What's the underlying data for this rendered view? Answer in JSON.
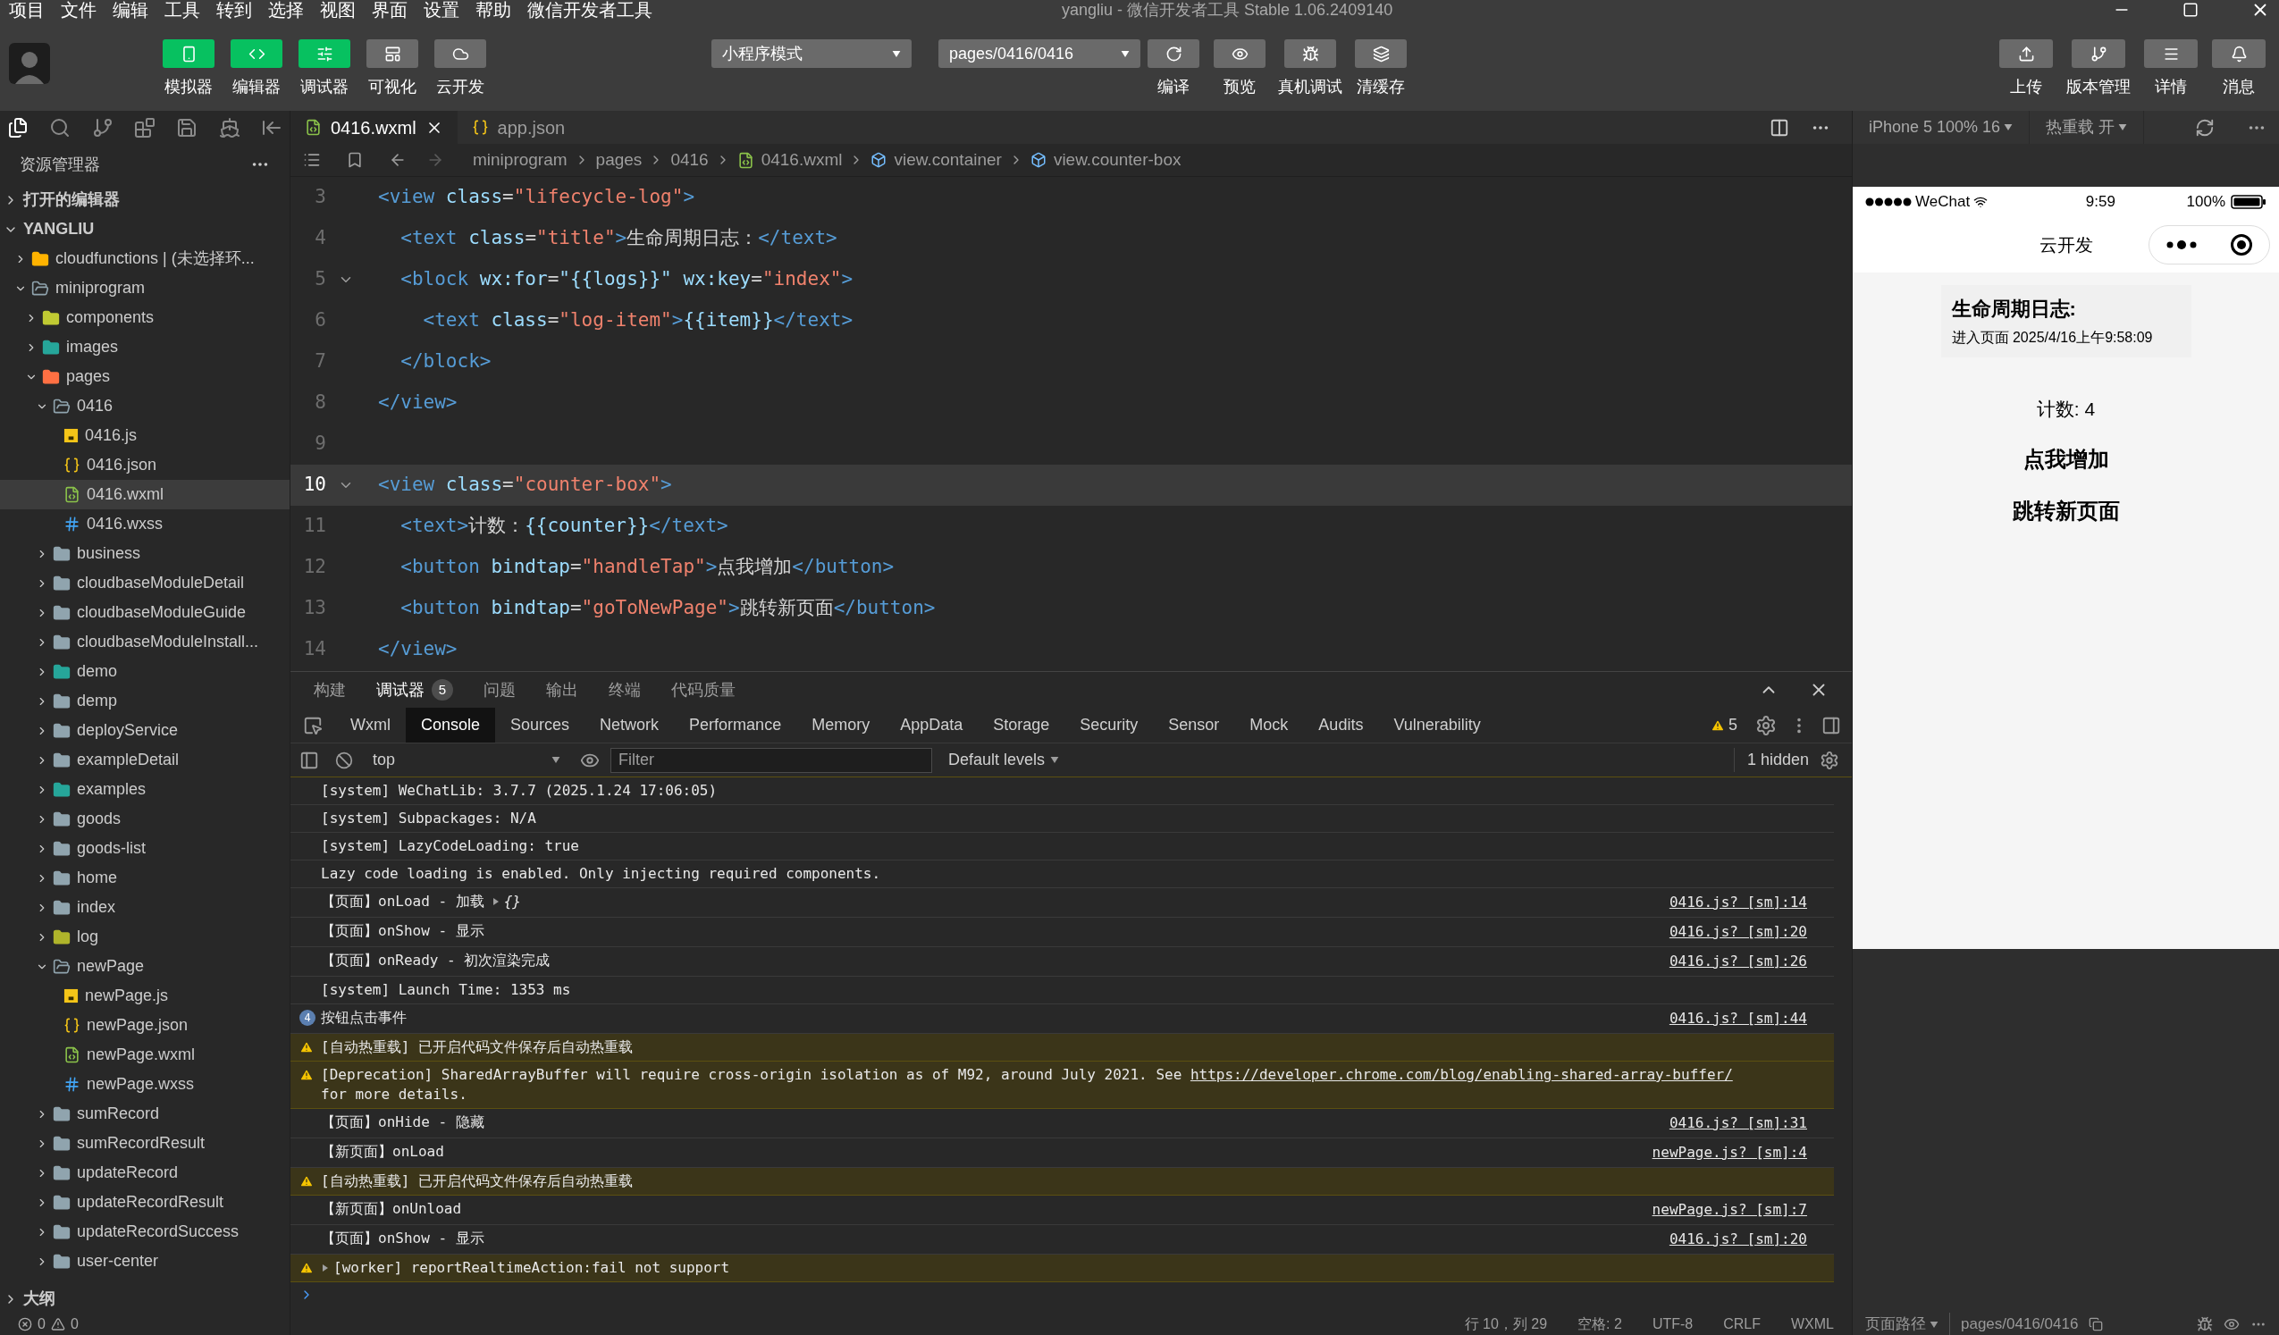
{
  "menu_bar": {
    "items": [
      "项目",
      "文件",
      "编辑",
      "工具",
      "转到",
      "选择",
      "视图",
      "界面",
      "设置",
      "帮助",
      "微信开发者工具"
    ],
    "title": "yangliu - 微信开发者工具 Stable 1.06.2409140"
  },
  "toolbar": {
    "modes": [
      {
        "label": "模拟器",
        "kind": "simulator",
        "on": true
      },
      {
        "label": "编辑器",
        "kind": "editor",
        "on": true
      },
      {
        "label": "调试器",
        "kind": "debugger",
        "on": true
      },
      {
        "label": "可视化",
        "kind": "visual",
        "on": false
      },
      {
        "label": "云开发",
        "kind": "cloud",
        "on": false
      }
    ],
    "mode_select": "小程序模式",
    "page_select": "pages/0416/0416",
    "actions": [
      {
        "label": "编译",
        "kind": "compile"
      },
      {
        "label": "预览",
        "kind": "preview"
      },
      {
        "label": "真机调试",
        "kind": "debug"
      },
      {
        "label": "清缓存",
        "kind": "cache"
      }
    ],
    "right_actions": [
      {
        "label": "上传",
        "kind": "upload"
      },
      {
        "label": "版本管理",
        "kind": "version"
      },
      {
        "label": "详情",
        "kind": "details"
      },
      {
        "label": "消息",
        "kind": "messages"
      }
    ]
  },
  "sidebar": {
    "title": "资源管理器",
    "sections": [
      {
        "label": "打开的编辑器",
        "expanded": false
      },
      {
        "label": "YANGLIU",
        "expanded": true,
        "children": [
          {
            "label": "cloudfunctions | (未选择环...",
            "kind": "cloud",
            "expanded": false,
            "selected": false
          },
          {
            "label": "miniprogram",
            "kind": "folder",
            "expanded": true,
            "selected": false,
            "children": [
              {
                "label": "components",
                "kind": "components",
                "expanded": false,
                "selected": false
              },
              {
                "label": "images",
                "kind": "images",
                "expanded": false,
                "selected": false
              },
              {
                "label": "pages",
                "kind": "pages",
                "expanded": true,
                "selected": false,
                "children": [
                  {
                    "label": "0416",
                    "kind": "folder",
                    "expanded": true,
                    "selected": false,
                    "children": [
                      {
                        "label": "0416.js",
                        "kind": "js",
                        "selected": false
                      },
                      {
                        "label": "0416.json",
                        "kind": "json",
                        "selected": false
                      },
                      {
                        "label": "0416.wxml",
                        "kind": "wxml",
                        "selected": true
                      },
                      {
                        "label": "0416.wxss",
                        "kind": "wxss",
                        "selected": false
                      }
                    ]
                  },
                  {
                    "label": "business",
                    "kind": "folder",
                    "expanded": false,
                    "selected": false
                  },
                  {
                    "label": "cloudbaseModuleDetail",
                    "kind": "folder",
                    "expanded": false,
                    "selected": false
                  },
                  {
                    "label": "cloudbaseModuleGuide",
                    "kind": "folder",
                    "expanded": false,
                    "selected": false
                  },
                  {
                    "label": "cloudbaseModuleInstall...",
                    "kind": "folder",
                    "expanded": false,
                    "selected": false
                  },
                  {
                    "label": "demo",
                    "kind": "images",
                    "expanded": false,
                    "selected": false
                  },
                  {
                    "label": "demp",
                    "kind": "folder",
                    "expanded": false,
                    "selected": false
                  },
                  {
                    "label": "deployService",
                    "kind": "folder",
                    "expanded": false,
                    "selected": false
                  },
                  {
                    "label": "exampleDetail",
                    "kind": "folder",
                    "expanded": false,
                    "selected": false
                  },
                  {
                    "label": "examples",
                    "kind": "images",
                    "expanded": false,
                    "selected": false
                  },
                  {
                    "label": "goods",
                    "kind": "folder",
                    "expanded": false,
                    "selected": false
                  },
                  {
                    "label": "goods-list",
                    "kind": "folder",
                    "expanded": false,
                    "selected": false
                  },
                  {
                    "label": "home",
                    "kind": "folder",
                    "expanded": false,
                    "selected": false
                  },
                  {
                    "label": "index",
                    "kind": "folder",
                    "expanded": false,
                    "selected": false
                  },
                  {
                    "label": "log",
                    "kind": "log",
                    "expanded": false,
                    "selected": false
                  },
                  {
                    "label": "newPage",
                    "kind": "folder",
                    "expanded": true,
                    "selected": false,
                    "children": [
                      {
                        "label": "newPage.js",
                        "kind": "js",
                        "selected": false
                      },
                      {
                        "label": "newPage.json",
                        "kind": "json",
                        "selected": false
                      },
                      {
                        "label": "newPage.wxml",
                        "kind": "wxml",
                        "selected": false
                      },
                      {
                        "label": "newPage.wxss",
                        "kind": "wxss",
                        "selected": false
                      }
                    ]
                  },
                  {
                    "label": "sumRecord",
                    "kind": "folder",
                    "expanded": false,
                    "selected": false
                  },
                  {
                    "label": "sumRecordResult",
                    "kind": "folder",
                    "expanded": false,
                    "selected": false
                  },
                  {
                    "label": "updateRecord",
                    "kind": "folder",
                    "expanded": false,
                    "selected": false
                  },
                  {
                    "label": "updateRecordResult",
                    "kind": "folder",
                    "expanded": false,
                    "selected": false
                  },
                  {
                    "label": "updateRecordSuccess",
                    "kind": "folder",
                    "expanded": false,
                    "selected": false
                  },
                  {
                    "label": "user-center",
                    "kind": "folder",
                    "expanded": false,
                    "selected": false
                  }
                ]
              }
            ]
          }
        ]
      },
      {
        "label": "大纲",
        "expanded": false
      }
    ]
  },
  "editor": {
    "tabs": [
      {
        "label": "0416.wxml",
        "kind": "wxml",
        "selected": true
      },
      {
        "label": "app.json",
        "kind": "json",
        "selected": false
      }
    ],
    "breadcrumb": [
      {
        "label": "miniprogram",
        "kind": "dir"
      },
      {
        "label": "pages",
        "kind": "dir"
      },
      {
        "label": "0416",
        "kind": "dir"
      },
      {
        "label": "0416.wxml",
        "kind": "wxml"
      },
      {
        "label": "view.container",
        "kind": "element"
      },
      {
        "label": "view.counter-box",
        "kind": "element"
      }
    ],
    "lines": [
      {
        "number": "3",
        "current": false,
        "foldable": false,
        "tokens": [
          {
            "t": "<view",
            "kind": "tag"
          },
          {
            "t": " class",
            "kind": "attr"
          },
          {
            "t": "=",
            "kind": "text"
          },
          {
            "t": "\"lifecycle-log\"",
            "kind": "str"
          },
          {
            "t": ">",
            "kind": "tag"
          }
        ]
      },
      {
        "number": "4",
        "current": false,
        "foldable": false,
        "tokens": [
          {
            "t": "  <text",
            "kind": "tag"
          },
          {
            "t": " class",
            "kind": "attr"
          },
          {
            "t": "=",
            "kind": "text"
          },
          {
            "t": "\"title\"",
            "kind": "str"
          },
          {
            "t": ">",
            "kind": "tag"
          },
          {
            "t": "生命周期日志：",
            "kind": "text"
          },
          {
            "t": "</text>",
            "kind": "tag"
          }
        ]
      },
      {
        "number": "5",
        "current": false,
        "foldable": true,
        "tokens": [
          {
            "t": "  <block",
            "kind": "tag"
          },
          {
            "t": " wx:for",
            "kind": "attr"
          },
          {
            "t": "=",
            "kind": "text"
          },
          {
            "t": "\"{{logs}}\"",
            "kind": "expr"
          },
          {
            "t": " wx:key",
            "kind": "attr"
          },
          {
            "t": "=",
            "kind": "text"
          },
          {
            "t": "\"index\"",
            "kind": "str"
          },
          {
            "t": ">",
            "kind": "tag"
          }
        ]
      },
      {
        "number": "6",
        "current": false,
        "foldable": false,
        "tokens": [
          {
            "t": "    <text",
            "kind": "tag"
          },
          {
            "t": " class",
            "kind": "attr"
          },
          {
            "t": "=",
            "kind": "text"
          },
          {
            "t": "\"log-item\"",
            "kind": "str"
          },
          {
            "t": ">",
            "kind": "tag"
          },
          {
            "t": "{{item}}",
            "kind": "expr"
          },
          {
            "t": "</text>",
            "kind": "tag"
          }
        ]
      },
      {
        "number": "7",
        "current": false,
        "foldable": false,
        "tokens": [
          {
            "t": "  </block>",
            "kind": "tag"
          }
        ]
      },
      {
        "number": "8",
        "current": false,
        "foldable": false,
        "tokens": [
          {
            "t": "</view>",
            "kind": "tag"
          }
        ]
      },
      {
        "number": "9",
        "current": false,
        "foldable": false
      },
      {
        "number": "10",
        "current": true,
        "foldable": true,
        "tokens": [
          {
            "t": "<view",
            "kind": "tag"
          },
          {
            "t": " class",
            "kind": "attr"
          },
          {
            "t": "=",
            "kind": "text"
          },
          {
            "t": "\"counter-box\"",
            "kind": "str"
          },
          {
            "t": ">",
            "kind": "tag"
          }
        ]
      },
      {
        "number": "11",
        "current": false,
        "foldable": false,
        "tokens": [
          {
            "t": "  <text>",
            "kind": "tag"
          },
          {
            "t": "计数：",
            "kind": "text"
          },
          {
            "t": "{{counter}}",
            "kind": "expr"
          },
          {
            "t": "</text>",
            "kind": "tag"
          }
        ]
      },
      {
        "number": "12",
        "current": false,
        "foldable": false,
        "tokens": [
          {
            "t": "  <button",
            "kind": "tag"
          },
          {
            "t": " bindtap",
            "kind": "attr"
          },
          {
            "t": "=",
            "kind": "text"
          },
          {
            "t": "\"handleTap\"",
            "kind": "str"
          },
          {
            "t": ">",
            "kind": "tag"
          },
          {
            "t": "点我增加",
            "kind": "text"
          },
          {
            "t": "</button>",
            "kind": "tag"
          }
        ]
      },
      {
        "number": "13",
        "current": false,
        "foldable": false,
        "tokens": [
          {
            "t": "  <button",
            "kind": "tag"
          },
          {
            "t": " bindtap",
            "kind": "attr"
          },
          {
            "t": "=",
            "kind": "text"
          },
          {
            "t": "\"goToNewPage\"",
            "kind": "str"
          },
          {
            "t": ">",
            "kind": "tag"
          },
          {
            "t": "跳转新页面",
            "kind": "text"
          },
          {
            "t": "</button>",
            "kind": "tag"
          }
        ]
      },
      {
        "number": "14",
        "current": false,
        "foldable": false,
        "tokens": [
          {
            "t": "</view>",
            "kind": "tag"
          }
        ]
      }
    ]
  },
  "panel": {
    "tabs": [
      {
        "label": "构建",
        "selected": false
      },
      {
        "label": "调试器",
        "selected": true,
        "badge": "5"
      },
      {
        "label": "问题",
        "selected": false
      },
      {
        "label": "输出",
        "selected": false
      },
      {
        "label": "终端",
        "selected": false
      },
      {
        "label": "代码质量",
        "selected": false
      }
    ],
    "devtools_tabs": [
      {
        "label": "Wxml",
        "selected": false
      },
      {
        "label": "Console",
        "selected": true
      },
      {
        "label": "Sources",
        "selected": false
      },
      {
        "label": "Network",
        "selected": false
      },
      {
        "label": "Performance",
        "selected": false
      },
      {
        "label": "Memory",
        "selected": false
      },
      {
        "label": "AppData",
        "selected": false
      },
      {
        "label": "Storage",
        "selected": false
      },
      {
        "label": "Security",
        "selected": false
      },
      {
        "label": "Sensor",
        "selected": false
      },
      {
        "label": "Mock",
        "selected": false
      },
      {
        "label": "Audits",
        "selected": false
      },
      {
        "label": "Vulnerability",
        "selected": false
      }
    ],
    "warning_count": "5",
    "context": "top",
    "filter_placeholder": "Filter",
    "levels": "Default levels",
    "hidden": "1 hidden",
    "entries": [
      {
        "kind": "log",
        "expandable": false,
        "text": "[system] WeChatLib: 3.7.7 (2025.1.24 17:06:05)"
      },
      {
        "kind": "log",
        "expandable": false,
        "text": "[system] Subpackages: N/A"
      },
      {
        "kind": "log",
        "expandable": false,
        "text": "[system] LazyCodeLoading: true"
      },
      {
        "kind": "log",
        "expandable": false,
        "text": "Lazy code loading is enabled. Only injecting required components."
      },
      {
        "kind": "log",
        "expandable": false,
        "text": "【页面】onLoad - 加载",
        "object": "{}",
        "source": "0416.js? [sm]:14"
      },
      {
        "kind": "log",
        "expandable": false,
        "text": "【页面】onShow - 显示",
        "source": "0416.js? [sm]:20"
      },
      {
        "kind": "log",
        "expandable": false,
        "text": "【页面】onReady - 初次渲染完成",
        "source": "0416.js? [sm]:26"
      },
      {
        "kind": "log",
        "expandable": false,
        "text": "[system] Launch Time: 1353 ms"
      },
      {
        "kind": "count",
        "expandable": false,
        "count": "4",
        "text": "按钮点击事件",
        "source": "0416.js? [sm]:44"
      },
      {
        "kind": "warn",
        "expandable": false,
        "text": "[自动热重载] 已开启代码文件保存后自动热重载"
      },
      {
        "kind": "warn",
        "expandable": false,
        "text": "[Deprecation] SharedArrayBuffer will require cross-origin isolation as of M92, around July 2021. See ",
        "link": "https://developer.chrome.com/blog/enabling-shared-array-buffer/",
        "text_after": "for more details."
      },
      {
        "kind": "log",
        "expandable": false,
        "text": "【页面】onHide - 隐藏",
        "source": "0416.js? [sm]:31"
      },
      {
        "kind": "log",
        "expandable": false,
        "text": "【新页面】onLoad",
        "source": "newPage.js? [sm]:4"
      },
      {
        "kind": "warn",
        "expandable": false,
        "text": "[自动热重载] 已开启代码文件保存后自动热重载"
      },
      {
        "kind": "log",
        "expandable": false,
        "text": "【新页面】onUnload",
        "source": "newPage.js? [sm]:7"
      },
      {
        "kind": "log",
        "expandable": false,
        "text": "【页面】onShow - 显示",
        "source": "0416.js? [sm]:20"
      },
      {
        "kind": "warn",
        "expandable": true,
        "text": "[worker] reportRealtimeAction:fail not support"
      }
    ]
  },
  "status_bar": {
    "errors": "0",
    "warnings": "0",
    "items": [
      "行 10，列 29",
      "空格: 2",
      "UTF-8",
      "CRLF",
      "WXML"
    ]
  },
  "simulator": {
    "device": "iPhone 5 100% 16",
    "hot_reload": "热重载 开",
    "phone": {
      "carrier": "WeChat",
      "time": "9:59",
      "battery": "100%",
      "nav_title": "云开发",
      "log_title": "生命周期日志:",
      "log_items": [
        "进入页面 2025/4/16上午9:58:09"
      ],
      "counter": "计数: 4",
      "buttons": [
        "点我增加",
        "跳转新页面"
      ]
    },
    "path_label": "页面路径",
    "path": "pages/0416/0416"
  }
}
